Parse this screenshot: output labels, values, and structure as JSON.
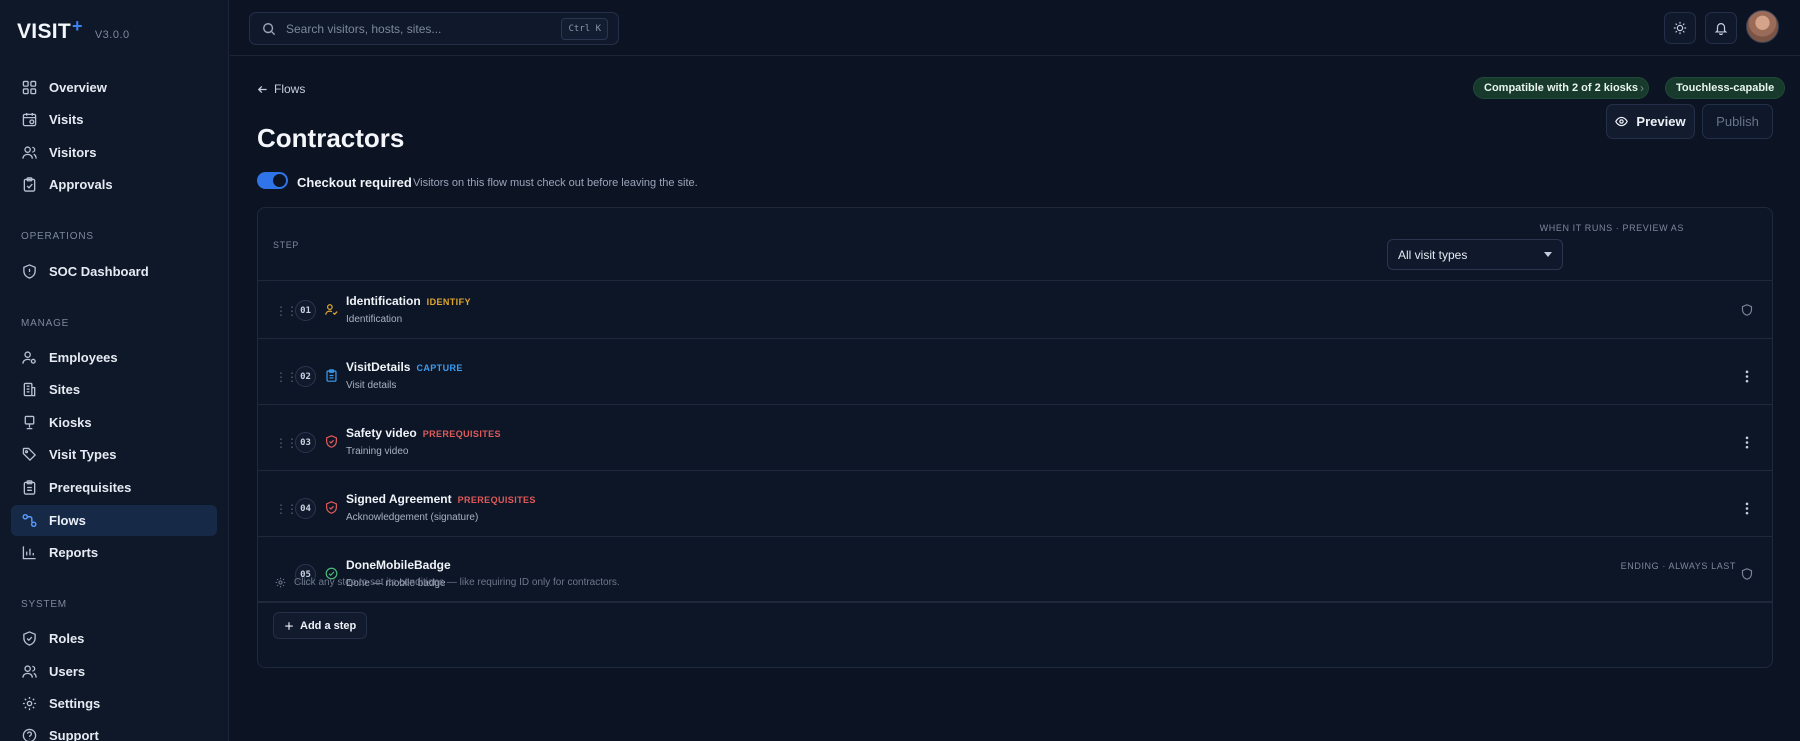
{
  "app": {
    "brand": "VISIT",
    "brand_plus": "+",
    "version": "V3.0.0"
  },
  "search": {
    "placeholder": "Search visitors, hosts, sites...",
    "shortcut": "Ctrl K"
  },
  "nav": {
    "main": [
      {
        "label": "Overview",
        "icon": "grid-icon"
      },
      {
        "label": "Visits",
        "icon": "calendar-icon"
      },
      {
        "label": "Visitors",
        "icon": "users-icon"
      },
      {
        "label": "Approvals",
        "icon": "clipboard-check-icon"
      }
    ],
    "operations_heading": "OPERATIONS",
    "operations": [
      {
        "label": "SOC Dashboard",
        "icon": "shield-icon"
      }
    ],
    "manage_heading": "MANAGE",
    "manage": [
      {
        "label": "Employees",
        "icon": "user-cog-icon"
      },
      {
        "label": "Sites",
        "icon": "building-icon"
      },
      {
        "label": "Kiosks",
        "icon": "kiosk-icon"
      },
      {
        "label": "Visit Types",
        "icon": "tag-icon"
      },
      {
        "label": "Prerequisites",
        "icon": "clipboard-list-icon"
      },
      {
        "label": "Flows",
        "icon": "flow-icon",
        "active": true
      },
      {
        "label": "Reports",
        "icon": "bar-chart-icon"
      }
    ],
    "system_heading": "SYSTEM",
    "system": [
      {
        "label": "Roles",
        "icon": "shield-check-icon"
      },
      {
        "label": "Users",
        "icon": "users-icon"
      },
      {
        "label": "Settings",
        "icon": "gear-icon"
      },
      {
        "label": "Support",
        "icon": "help-icon"
      }
    ]
  },
  "page": {
    "breadcrumb": "Flows",
    "title": "Contractors",
    "compat_pill": "Compatible with 2 of 2 kiosks",
    "touchless_pill": "Touchless-capable",
    "preview_label": "Preview",
    "publish_label": "Publish",
    "checkout": {
      "enabled": true,
      "label": "Checkout required",
      "description": "Visitors on this flow must check out before leaving the site."
    }
  },
  "steps_table": {
    "col_step": "STEP",
    "when_label": "WHEN IT RUNS · PREVIEW AS",
    "preview_as_selected": "All visit types",
    "steps": [
      {
        "number": "01",
        "name": "Identification",
        "tag": "IDENTIFY",
        "tag_color": "#e0a82e",
        "subtitle": "Identification",
        "icon": "user-check-icon",
        "icon_color": "#e0a82e",
        "right": "shield-icon"
      },
      {
        "number": "02",
        "name": "VisitDetails",
        "tag": "CAPTURE",
        "tag_color": "#3b9cf0",
        "subtitle": "Visit details",
        "icon": "clipboard-icon",
        "icon_color": "#3b9cf0",
        "right": "kebab-icon"
      },
      {
        "number": "03",
        "name": "Safety video",
        "tag": "PREREQUISITES",
        "tag_color": "#e05a5a",
        "subtitle": "Training video",
        "icon": "shield-check-icon",
        "icon_color": "#e05a5a",
        "right": "kebab-icon"
      },
      {
        "number": "04",
        "name": "Signed Agreement",
        "tag": "PREREQUISITES",
        "tag_color": "#e05a5a",
        "subtitle": "Acknowledgement (signature)",
        "icon": "shield-check-icon",
        "icon_color": "#e05a5a",
        "right": "kebab-icon"
      },
      {
        "number": "05",
        "name": "DoneMobileBadge",
        "tag": "",
        "tag_color": "#4cb87a",
        "subtitle": "Done — mobile badge",
        "icon": "check-circle-icon",
        "icon_color": "#4cb87a",
        "right": "shield-icon",
        "ending_label": "ENDING · ALWAYS LAST"
      }
    ],
    "hint": "Click any step to set its conditions — like requiring ID only for contractors.",
    "add_step_label": "Add a step"
  }
}
